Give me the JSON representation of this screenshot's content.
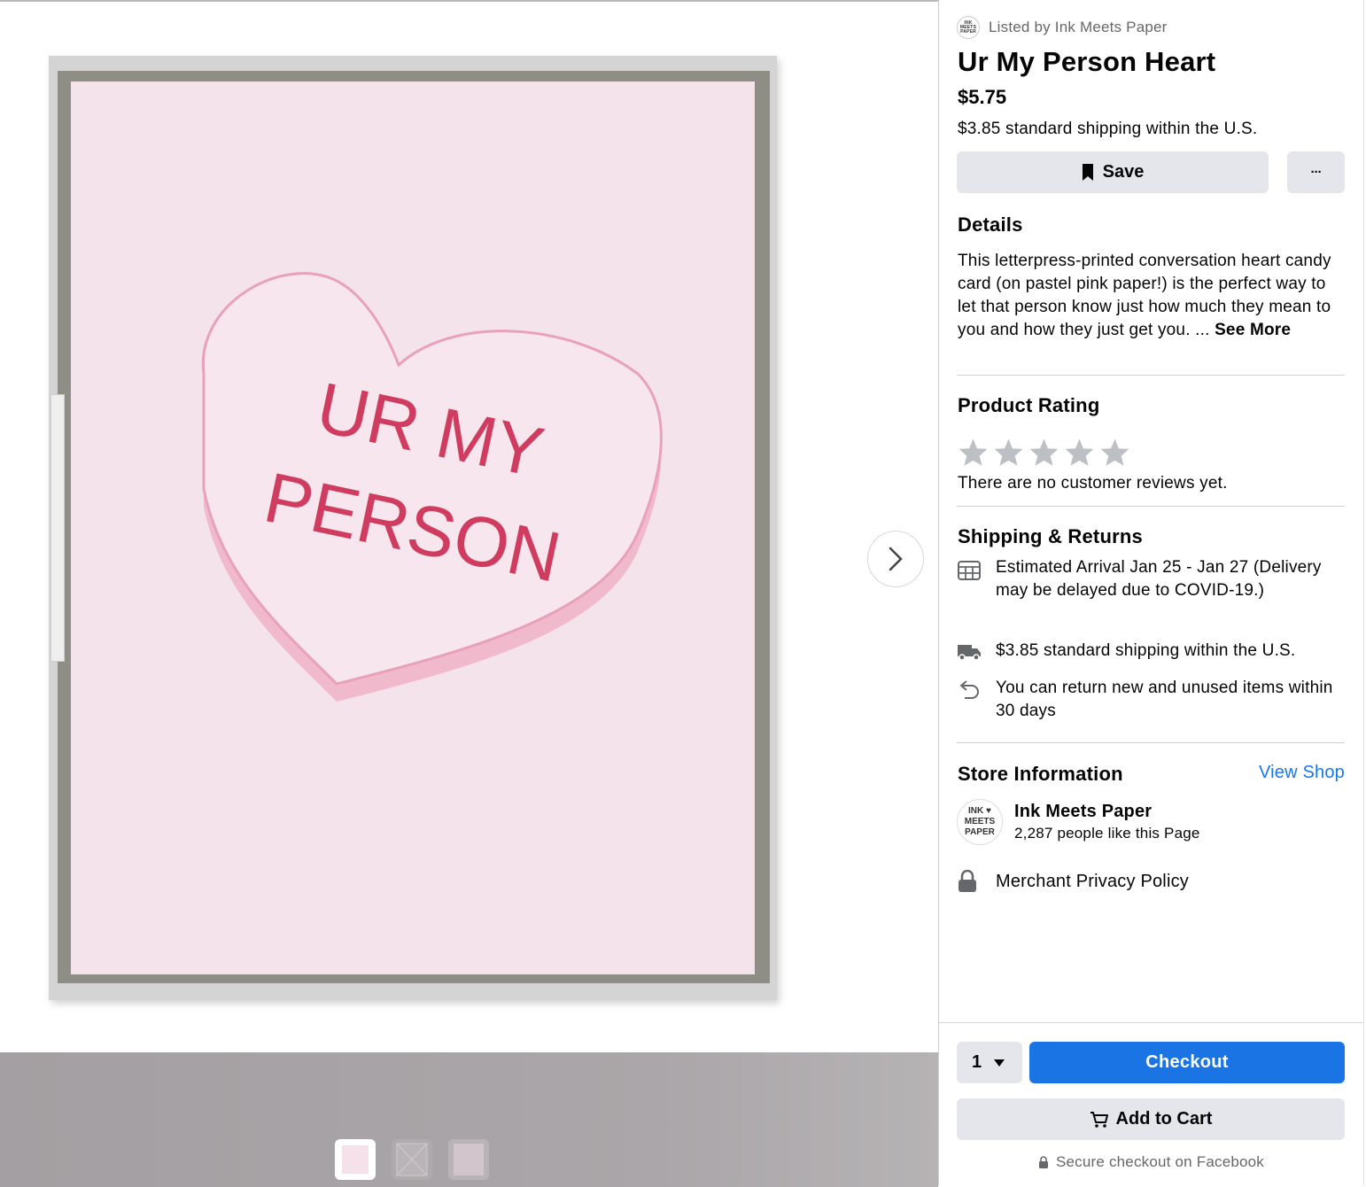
{
  "listing": {
    "listed_by": "Listed by Ink Meets Paper",
    "title": "Ur My Person Heart",
    "price": "$5.75",
    "shipping": "$3.85 standard shipping within the U.S."
  },
  "actions": {
    "save_label": "Save",
    "more_label": "···"
  },
  "details": {
    "heading": "Details",
    "text": "This letterpress-printed conversation heart candy card (on pastel pink paper!) is the perfect way to let that person know just how much they mean to you and how they just get you. ... ",
    "see_more": "See More"
  },
  "rating": {
    "heading": "Product Rating",
    "stars_filled": 0,
    "stars_total": 5,
    "no_reviews": "There are no customer reviews yet."
  },
  "shipping_returns": {
    "heading": "Shipping & Returns",
    "arrival": "Estimated Arrival Jan 25 - Jan 27 (Delivery may be delayed due to COVID-19.)",
    "standard": "$3.85 standard shipping within the U.S.",
    "returns": "You can return new and unused items within 30 days"
  },
  "store": {
    "heading": "Store Information",
    "view_shop": "View Shop",
    "logo_lines": [
      "INK ♥",
      "MEETS",
      "PAPER"
    ],
    "name": "Ink Meets Paper",
    "likes": "2,287 people like this Page",
    "privacy": "Merchant Privacy Policy"
  },
  "purchase": {
    "quantity": "1",
    "checkout": "Checkout",
    "add_to_cart": "Add to Cart",
    "secure": "Secure checkout on Facebook"
  },
  "card_image": {
    "line1": "UR MY",
    "line2": "PERSON"
  },
  "colors": {
    "accent": "#1b74e4",
    "link": "#1877f2",
    "card_pink": "#f5e3ec",
    "letterpress_red": "#cf3c5f",
    "button_gray": "#e4e6eb"
  },
  "icons": [
    "bookmark-icon",
    "star-icon",
    "calendar-icon",
    "truck-icon",
    "return-arrow-icon",
    "lock-icon",
    "cart-icon",
    "chevron-right-icon",
    "caret-down-icon"
  ]
}
